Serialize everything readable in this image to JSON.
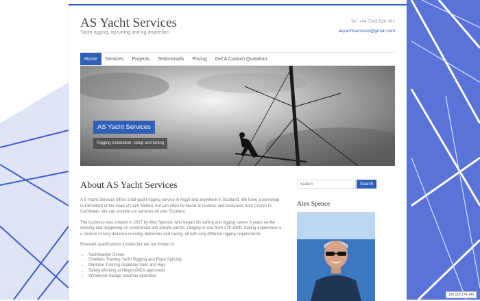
{
  "site": {
    "title": "AS Yacht Services",
    "tagline": "Yacht rigging, rig tuning and rig inspection",
    "tel": "Tel: +44 7342 920 301",
    "email": "asyachtservices@gmail.com"
  },
  "nav": {
    "items": [
      {
        "label": "Home",
        "active": true
      },
      {
        "label": "Services"
      },
      {
        "label": "Projects"
      },
      {
        "label": "Testimonials"
      },
      {
        "label": "Pricing"
      },
      {
        "label": "Get A Custom Quotation"
      }
    ]
  },
  "hero": {
    "title": "AS Yacht Services",
    "caption": "Rigging installation, setup and tuning"
  },
  "main": {
    "heading": "About AS Yacht Services",
    "paragraphs": [
      "A S Yacht Services offers a full yacht rigging service in Argyll and anywhere in  Scotland. We have  a workshop in Kilmelford at the head of Loch Melfort, but can often be found at marinas and boatyards from Creran to Cairnbaan.  We can provide our services all over Scotland.",
      "The business was created in 2017 by Alex Spence, who began his sailing and rigging career 8 years earlier crewing and skippering on commercial and private yachts, ranging in size from 27ft-180ft. Sailing experience is a mixture of  long distance cruising, deliveries and racing, all with very different rigging requirements.",
      "Relevant qualifications include but are not limited to:"
    ],
    "qualifications": [
      "Yachtmaster Ocean",
      "Chieftain Training Yacht Rigging and Rope Splicing",
      "Maritime Training Academy Sails and Rigs",
      "Safety Working at Height (MCA approved)",
      "Wireteknik Swage machine operative"
    ]
  },
  "sidebar": {
    "search_placeholder": "Search",
    "search_button": "Search",
    "profile_title": "Alex Spence"
  },
  "ip_address": "185.119.174.149"
}
